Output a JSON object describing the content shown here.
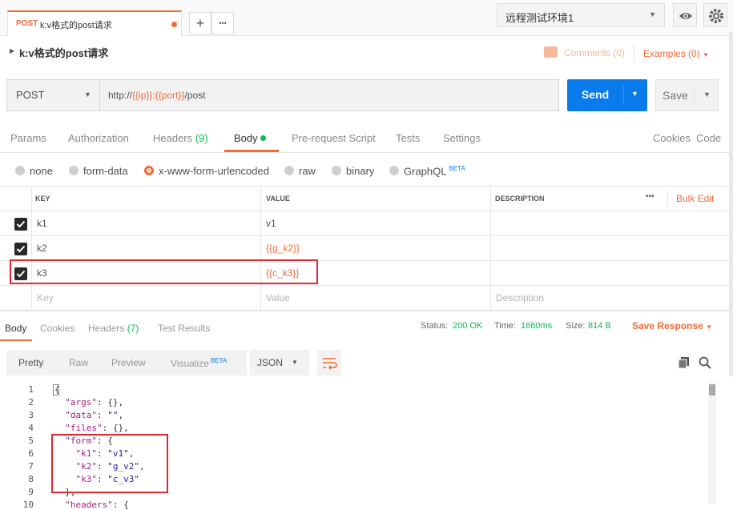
{
  "tab": {
    "method": "POST",
    "name": "k:v格式的post请求"
  },
  "tabbar": {
    "add_symbol": "+",
    "more_symbol": "•••"
  },
  "environment": {
    "selected": "远程测试环境1"
  },
  "request": {
    "title": "k:v格式的post请求",
    "comments": "Comments (0)",
    "examples": "Examples (0)",
    "method": "POST",
    "url_prefix": "http://",
    "url_var1": "{{ip}}",
    "url_colon": ":",
    "url_var2": "{{port}}",
    "url_suffix": "/post",
    "send_label": "Send",
    "save_label": "Save"
  },
  "request_tabs": {
    "params": "Params",
    "authorization": "Authorization",
    "headers": "Headers",
    "headers_count": "(9)",
    "body": "Body",
    "prerequest": "Pre-request Script",
    "tests": "Tests",
    "settings": "Settings",
    "cookies": "Cookies",
    "code": "Code"
  },
  "body_types": {
    "none": "none",
    "form_data": "form-data",
    "urlencoded": "x-www-form-urlencoded",
    "raw": "raw",
    "binary": "binary",
    "graphql": "GraphQL",
    "beta": "BETA"
  },
  "kv_table": {
    "headers": {
      "key": "KEY",
      "value": "VALUE",
      "description": "DESCRIPTION",
      "more": "•••",
      "bulk_edit": "Bulk Edit"
    },
    "rows": [
      {
        "key": "k1",
        "value": "v1",
        "checked": true
      },
      {
        "key": "k2",
        "value": "{{g_k2}}",
        "checked": true
      },
      {
        "key": "k3",
        "value": "{{c_k3}}",
        "checked": true
      }
    ],
    "placeholders": {
      "key": "Key",
      "value": "Value",
      "description": "Description"
    }
  },
  "response": {
    "tabs": {
      "body": "Body",
      "cookies": "Cookies",
      "headers": "Headers",
      "headers_count": "(7)",
      "test_results": "Test Results"
    },
    "status_label": "Status:",
    "status_value": "200 OK",
    "time_label": "Time:",
    "time_value": "1660ms",
    "size_label": "Size:",
    "size_value": "814 B",
    "save_response": "Save Response",
    "view_modes": {
      "pretty": "Pretty",
      "raw": "Raw",
      "preview": "Preview",
      "visualize": "Visualize",
      "beta": "BETA"
    },
    "format": "JSON",
    "code_lines": [
      {
        "n": "1",
        "t": "{"
      },
      {
        "n": "2",
        "t": "  \"args\": {},"
      },
      {
        "n": "3",
        "t": "  \"data\": \"\","
      },
      {
        "n": "4",
        "t": "  \"files\": {},"
      },
      {
        "n": "5",
        "t": "  \"form\": {"
      },
      {
        "n": "6",
        "t": "    \"k1\": \"v1\","
      },
      {
        "n": "7",
        "t": "    \"k2\": \"g_v2\","
      },
      {
        "n": "8",
        "t": "    \"k3\": \"c_v3\""
      },
      {
        "n": "9",
        "t": "  },"
      },
      {
        "n": "10",
        "t": "  \"headers\": {"
      }
    ]
  },
  "colors": {
    "accent": "#f26b3a",
    "send": "#097bed",
    "highlight": "#e0292e",
    "green": "#0cbb52"
  }
}
